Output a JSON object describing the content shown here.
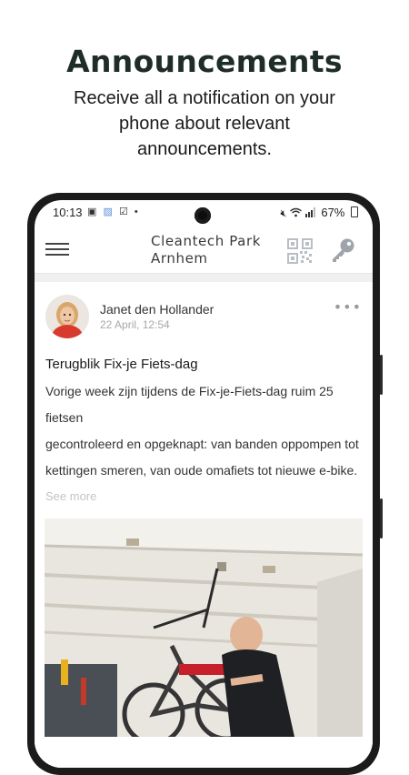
{
  "promo": {
    "headline": "Announcements",
    "subline": "Receive all a notification on your phone about relevant announcements."
  },
  "statusbar": {
    "time": "10:13",
    "left_icons": [
      "gallery-icon",
      "pattern-icon",
      "checkbox-icon",
      "dot-icon"
    ],
    "right_icons": [
      "mute-icon",
      "wifi-icon",
      "signal-icon",
      "battery-icon"
    ],
    "battery": "67%"
  },
  "appbar": {
    "brand_line1": "Cleantech Park",
    "brand_line2": "Arnhem",
    "icons": [
      "menu-icon",
      "qr-code-icon",
      "key-icon"
    ]
  },
  "post": {
    "author": "Janet den Hollander",
    "date": "22 April, 12:54",
    "menu": "•••",
    "title": "Terugblik Fix-je Fiets-dag",
    "body_lines": [
      "Vorige week zijn tijdens de Fix-je-Fiets-dag ruim 25",
      "fietsen",
      "gecontroleerd en opgeknapt: van banden oppompen tot",
      "kettingen smeren, van oude omafiets tot nieuwe e-bike."
    ],
    "see_more": "See more"
  },
  "colors": {
    "headline": "#1f2d29",
    "phone_frame": "#1b1b1b",
    "feed_background": "#f0f0f0",
    "muted_text": "#a8a8a8"
  }
}
